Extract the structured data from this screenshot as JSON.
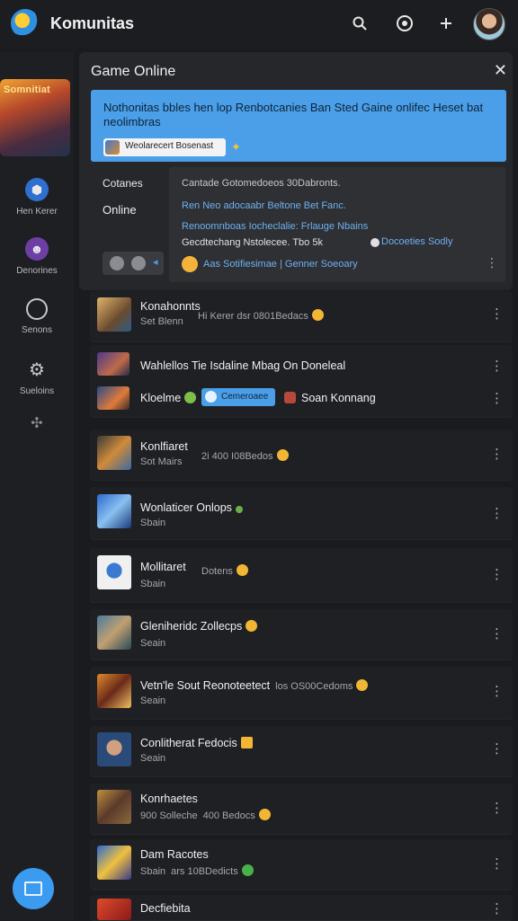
{
  "app": {
    "title": "Komunitas"
  },
  "sidebar": {
    "banner_text": "Somnitiat",
    "items": [
      {
        "label": "Hen Kerer",
        "icon": "hexagon-icon",
        "color": "#3b8ef0"
      },
      {
        "label": "Denorines",
        "icon": "mask-icon",
        "color": "#a26ad6"
      },
      {
        "label": "Senons",
        "icon": "ring-icon",
        "color": "#c7c8cc"
      },
      {
        "label": "Sueloins",
        "icon": "gear-icon",
        "color": "#c7c8cc"
      },
      {
        "label": "",
        "icon": "puzzle-icon",
        "color": "#8c8d93"
      }
    ]
  },
  "panel": {
    "title": "Game Online",
    "banner_text": "Nothonitas bbles hen lop Renbotcanies Ban Sted Gaine onlifec Heset bat neolimbras",
    "chip_text": "Weolarecert Bosenast",
    "tab_a": "Cotanes",
    "tab_b": "Online",
    "dropdown": {
      "l1": "Cantade Gotomedoeos 30Dabronts.",
      "l2": "Ren Neo adocaabr Beltone Bet Fanc.",
      "l3": "Renoomnboas Iocheclalie: Frlauge Nbains",
      "l4": "Gecdtechang Nstolecee. Tbo 5k",
      "l4b": "Docoeties Sodly",
      "l5": "Aas Sotifiesimae | Genner Soeoary"
    }
  },
  "list": [
    {
      "name": "Konahonnts",
      "sub": "Set Blenn",
      "sub2": "Hi Kerer dsr 0801Bedacs",
      "emoji": true
    },
    {
      "name": "Wahlellos Tie Isdaline Mbag On Doneleal",
      "sub": "",
      "emoji": false
    },
    {
      "name": "Kloelme",
      "join": "Cemeroaee",
      "sub2": "Soan Konnang"
    },
    {
      "name": "Konlfiaret",
      "sub": "Sot Mairs",
      "sub2": "2i 400 I08Bedos",
      "emoji": true
    },
    {
      "name": "Wonlaticer Onlops",
      "sub": "Sbain",
      "emoji": true
    },
    {
      "name": "Mollitaret",
      "sub": "Sbain",
      "sub2": "Dotens",
      "emoji": true
    },
    {
      "name": "Gleniheridc Zollecps",
      "sub": "Seain",
      "emoji": true
    },
    {
      "name": "Vetn'le Sout Reonoteetect",
      "sub": "Seain",
      "sub2": "los OS00Cedoms",
      "emoji": true
    },
    {
      "name": "Conlitherat Fedocis",
      "sub": "Seain",
      "emoji": true
    },
    {
      "name": "Konrhaetes",
      "sub": "900 Solleche",
      "sub2": "400 Bedocs",
      "emoji": true
    },
    {
      "name": "Dam Racotes",
      "sub": "Sbain",
      "sub2": "ars 10BDedicts",
      "emoji": true
    },
    {
      "name": "Decfiebita",
      "sub": "",
      "emoji": false
    }
  ]
}
